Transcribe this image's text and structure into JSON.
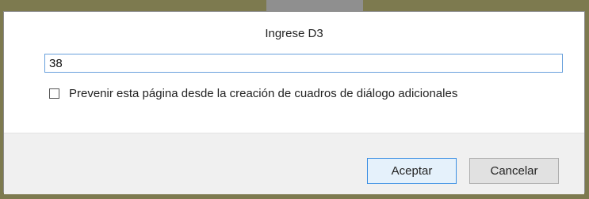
{
  "dialog": {
    "title": "Ingrese D3",
    "input": {
      "value": "38",
      "placeholder": ""
    },
    "checkbox": {
      "checked": false,
      "label": "Prevenir esta página desde la creación de cuadros de diálogo adicionales"
    },
    "buttons": {
      "accept_label": "Aceptar",
      "cancel_label": "Cancelar"
    }
  },
  "colors": {
    "background": "#7d7a4f",
    "dialog_footer": "#f0f0f0",
    "focus_border": "#68a0dc"
  }
}
